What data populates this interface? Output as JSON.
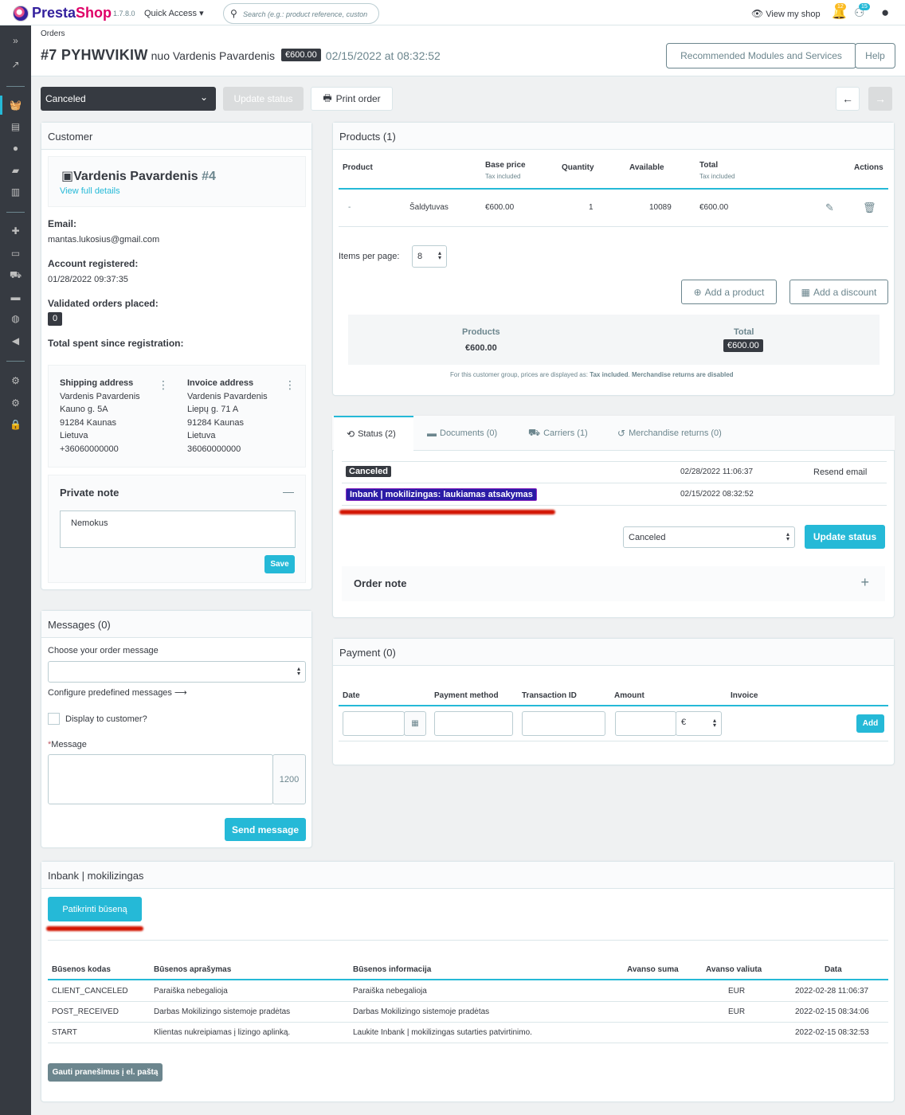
{
  "top": {
    "logo_a": "Presta",
    "logo_b": "Shop",
    "version": "1.7.8.0",
    "quick_access": "Quick Access",
    "search_placeholder": "Search (e.g.: product reference, custon",
    "view_shop": "View my shop",
    "notif_orders": "12",
    "notif_customers": "15"
  },
  "header": {
    "breadcrumb": "Orders",
    "order_ref": "#7 PYHWVIKIW",
    "customer": "nuo Vardenis Pavardenis",
    "total": "€600.00",
    "date": "02/15/2022 at 08:32:52",
    "btn_modules": "Recommended Modules and Services",
    "btn_help": "Help"
  },
  "toolbar": {
    "status": "Canceled",
    "update_status": "Update status",
    "print": "Print order"
  },
  "customer": {
    "title": "Customer",
    "name": "Vardenis Pavardenis",
    "id": "#4",
    "view_details": "View full details",
    "email_label": "Email:",
    "email": "mantas.lukosius@gmail.com",
    "registered_label": "Account registered:",
    "registered": "01/28/2022 09:37:35",
    "validated_label": "Validated orders placed:",
    "validated": "0",
    "spent_label": "Total spent since registration:"
  },
  "shipping": {
    "title": "Shipping address",
    "lines": [
      "Vardenis Pavardenis",
      "Kauno g. 5A",
      "91284 Kaunas",
      "Lietuva",
      "+36060000000"
    ]
  },
  "invoice": {
    "title": "Invoice address",
    "lines": [
      "Vardenis Pavardenis",
      "Liepų g. 71 A",
      "91284 Kaunas",
      "Lietuva",
      "36060000000"
    ]
  },
  "private_note": {
    "title": "Private note",
    "text": "Nemokus",
    "save": "Save"
  },
  "messages": {
    "title": "Messages (0)",
    "choose_label": "Choose your order message",
    "configure": "Configure predefined messages",
    "display_customer": "Display to customer?",
    "message_label": "Message",
    "counter": "1200",
    "send": "Send message"
  },
  "products": {
    "title": "Products (1)",
    "headers": {
      "product": "Product",
      "base_price": "Base price",
      "base_price_sub": "Tax included",
      "quantity": "Quantity",
      "available": "Available",
      "total": "Total",
      "total_sub": "Tax included",
      "actions": "Actions"
    },
    "row": {
      "name": "Šaldytuvas",
      "base_price": "€600.00",
      "quantity": "1",
      "available": "10089",
      "total": "€600.00"
    },
    "items_per_page_label": "Items per page:",
    "items_per_page": "8",
    "add_product": "Add a product",
    "add_discount": "Add a discount",
    "sum_products_label": "Products",
    "sum_products": "€600.00",
    "sum_total_label": "Total",
    "sum_total": "€600.00",
    "footnote_a": "For this customer group, prices are displayed as: ",
    "footnote_b": "Tax included",
    "footnote_c": ". ",
    "footnote_d": "Merchandise returns are disabled"
  },
  "tabs": [
    {
      "label": "Status (2)"
    },
    {
      "label": "Documents (0)"
    },
    {
      "label": "Carriers (1)"
    },
    {
      "label": "Merchandise returns (0)"
    }
  ],
  "history": [
    {
      "status": "Canceled",
      "date": "02/28/2022 11:06:37",
      "action": "Resend email",
      "color": "#363a41"
    },
    {
      "status": "Inbank | mokilizingas: laukiamas atsakymas",
      "date": "02/15/2022 08:32:52",
      "color": "#2a1ba6"
    }
  ],
  "status_select": "Canceled",
  "update_status_btn": "Update status",
  "order_note": "Order note",
  "payment": {
    "title": "Payment (0)",
    "headers": [
      "Date",
      "Payment method",
      "Transaction ID",
      "Amount",
      "Invoice"
    ],
    "currency": "€",
    "add": "Add"
  },
  "inbank": {
    "title": "Inbank | mokilizingas",
    "check_btn": "Patikrinti būseną",
    "headers": [
      "Būsenos kodas",
      "Būsenos aprašymas",
      "Būsenos informacija",
      "Avanso suma",
      "Avanso valiuta",
      "Data"
    ],
    "rows": [
      [
        "CLIENT_CANCELED",
        "Paraiška nebegalioja",
        "Paraiška nebegalioja",
        "",
        "EUR",
        "2022-02-28 11:06:37"
      ],
      [
        "POST_RECEIVED",
        "Darbas Mokilizingo sistemoje pradėtas",
        "Darbas Mokilizingo sistemoje pradėtas",
        "",
        "EUR",
        "2022-02-15 08:34:06"
      ],
      [
        "START",
        "Klientas nukreipiamas į lizingo aplinką.",
        "Laukite Inbank | mokilizingas sutarties patvirtinimo.",
        "",
        "",
        "2022-02-15 08:32:53"
      ]
    ],
    "email_btn": "Gauti pranešimus į el. paštą"
  }
}
